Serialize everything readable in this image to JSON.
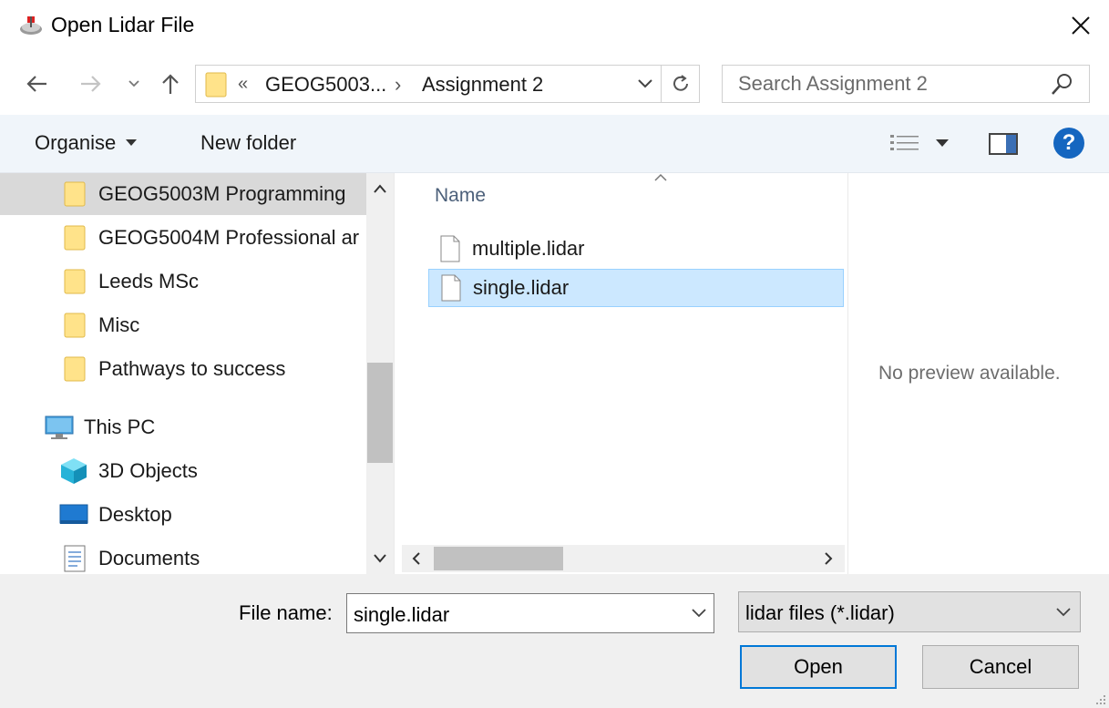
{
  "window": {
    "title": "Open Lidar File",
    "close_glyph": "✕"
  },
  "address": {
    "overflow": "«",
    "crumb1": "GEOG5003...",
    "separator": "›",
    "crumb2": "Assignment 2"
  },
  "search": {
    "placeholder": "Search Assignment 2"
  },
  "toolbar": {
    "organise_label": "Organise",
    "new_folder_label": "New folder",
    "help_glyph": "?"
  },
  "nav_pane": {
    "items": [
      {
        "label": "GEOG5003M Programming",
        "icon": "folder-icon"
      },
      {
        "label": "GEOG5004M Professional ar",
        "icon": "folder-icon"
      },
      {
        "label": "Leeds MSc",
        "icon": "folder-icon"
      },
      {
        "label": "Misc",
        "icon": "folder-icon"
      },
      {
        "label": "Pathways to success",
        "icon": "folder-icon"
      },
      {
        "label": "This PC",
        "icon": "computer-icon"
      },
      {
        "label": "3D Objects",
        "icon": "cube-icon"
      },
      {
        "label": "Desktop",
        "icon": "desktop-icon"
      },
      {
        "label": "Documents",
        "icon": "documents-icon"
      }
    ]
  },
  "file_list": {
    "column_header": "Name",
    "files": [
      {
        "name": "multiple.lidar",
        "selected": false
      },
      {
        "name": "single.lidar",
        "selected": true
      }
    ]
  },
  "preview": {
    "text": "No preview available."
  },
  "bottom": {
    "file_name_label": "File name:",
    "file_name_value": "single.lidar",
    "file_type_value": "lidar files (*.lidar)",
    "open_label": "Open",
    "cancel_label": "Cancel"
  },
  "colors": {
    "selection": "#cce8ff",
    "accent": "#0078d7",
    "folder": "#ffe38a"
  }
}
